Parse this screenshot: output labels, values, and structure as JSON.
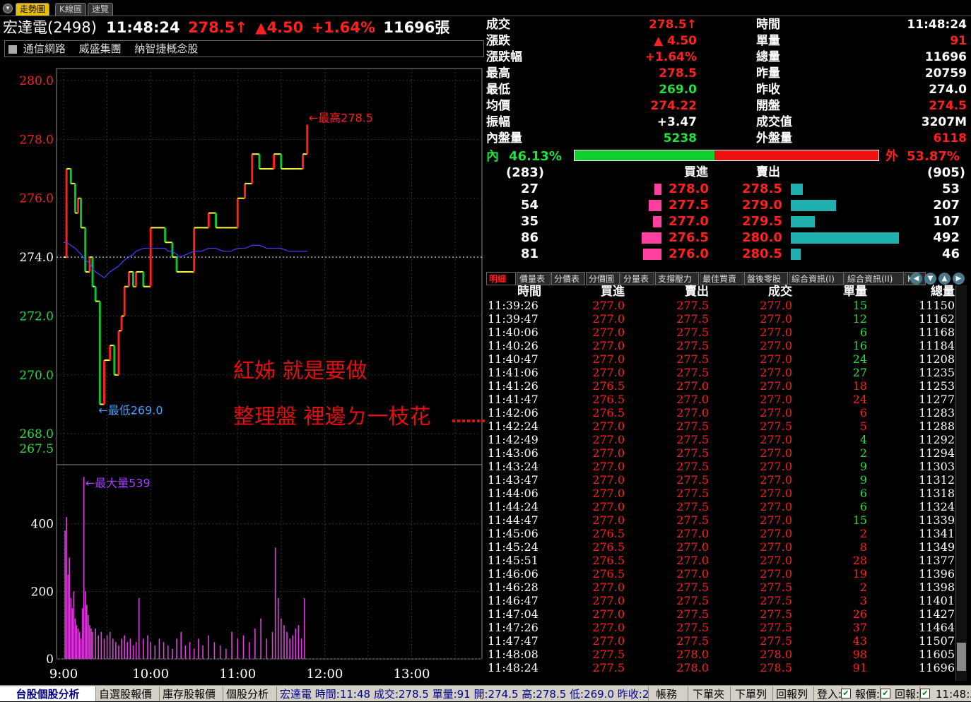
{
  "tabs": [
    {
      "label": "走勢圖"
    },
    {
      "label": "K線圖"
    },
    {
      "label": "速覽"
    }
  ],
  "stock": {
    "name": "宏達電(2498)",
    "time": "11:48:24",
    "price": "278.5",
    "price_arrow": "↑",
    "change": "▲4.50",
    "change_pct": "+1.64%",
    "volume": "11696張"
  },
  "tags": [
    "通信網路",
    "威盛集團",
    "納智捷概念股"
  ],
  "chart_data": [
    {
      "type": "line",
      "title": "",
      "x": [
        "9:00",
        "9:02",
        "9:05",
        "9:08",
        "9:10",
        "9:12",
        "9:15",
        "9:18",
        "9:20",
        "9:22",
        "9:25",
        "9:28",
        "9:30",
        "9:32",
        "9:35",
        "9:38",
        "9:40",
        "9:42",
        "9:45",
        "9:48",
        "9:50",
        "9:55",
        "10:00",
        "10:05",
        "10:10",
        "10:12",
        "10:15",
        "10:18",
        "10:20",
        "10:25",
        "10:30",
        "10:35",
        "10:40",
        "10:45",
        "10:50",
        "10:55",
        "11:00",
        "11:05",
        "11:10",
        "11:15",
        "11:20",
        "11:25",
        "11:30",
        "11:35",
        "11:40",
        "11:45",
        "11:48"
      ],
      "series": [
        {
          "values": [
            274.0,
            277.0,
            276.5,
            275.5,
            276.0,
            275.0,
            273.5,
            274.0,
            273.0,
            272.5,
            269.0,
            270.5,
            270.5,
            271.0,
            270.0,
            271.5,
            272.0,
            273.0,
            273.5,
            273.0,
            273.5,
            273.0,
            275.0,
            275.0,
            274.5,
            274.5,
            274.0,
            273.5,
            273.5,
            273.5,
            275.0,
            275.0,
            275.5,
            275.0,
            275.0,
            275.0,
            276.0,
            276.5,
            277.5,
            277.0,
            277.0,
            277.5,
            277.0,
            277.0,
            277.0,
            277.5,
            278.5
          ],
          "color": "#ffffff"
        },
        {
          "values": [
            274.5,
            274.5,
            274.4,
            274.3,
            274.2,
            274.1,
            273.9,
            273.8,
            273.6,
            273.5,
            273.4,
            273.3,
            273.4,
            273.5,
            273.6,
            273.7,
            273.8,
            273.9,
            274.0,
            274.1,
            274.2,
            274.3,
            274.3,
            274.3,
            274.3,
            274.2,
            274.2,
            274.1,
            274.0,
            274.1,
            274.2,
            274.2,
            274.3,
            274.3,
            274.2,
            274.2,
            274.3,
            274.3,
            274.4,
            274.4,
            274.3,
            274.3,
            274.3,
            274.2,
            274.2,
            274.2,
            274.2
          ],
          "color": "#4040ff"
        }
      ],
      "reference": 274.0,
      "y_ticks": [
        "280.0",
        "278.0",
        "276.0",
        "274.0",
        "272.0",
        "270.0",
        "268.0",
        "267.5"
      ],
      "ylim": [
        267.5,
        280.0
      ],
      "x_ticks": [
        "9:00",
        "10:00",
        "11:00",
        "12:00",
        "13:00"
      ],
      "annotations": {
        "high": "←最高278.5",
        "low": "←最低269.0"
      }
    },
    {
      "type": "bar",
      "title": "",
      "x_minutes": [
        1,
        2,
        3,
        4,
        5,
        6,
        7,
        8,
        9,
        10,
        11,
        12,
        13,
        14,
        15,
        16,
        17,
        18,
        19,
        20,
        22,
        24,
        26,
        28,
        30,
        32,
        34,
        36,
        38,
        40,
        42,
        44,
        46,
        48,
        50,
        52,
        55,
        58,
        60,
        63,
        66,
        69,
        72,
        75,
        78,
        81,
        84,
        87,
        90,
        93,
        96,
        100,
        104,
        108,
        112,
        116,
        120,
        124,
        128,
        132,
        136,
        140,
        144,
        146,
        148,
        150,
        152,
        154,
        156,
        158,
        160,
        162,
        164,
        166
      ],
      "values": [
        380,
        420,
        250,
        300,
        180,
        150,
        200,
        120,
        100,
        90,
        80,
        60,
        150,
        539,
        200,
        160,
        130,
        100,
        90,
        80,
        90,
        70,
        80,
        60,
        70,
        80,
        60,
        50,
        40,
        60,
        70,
        50,
        60,
        40,
        50,
        180,
        60,
        70,
        50,
        40,
        60,
        50,
        40,
        30,
        60,
        80,
        40,
        50,
        30,
        60,
        40,
        70,
        50,
        40,
        30,
        80,
        60,
        70,
        50,
        90,
        120,
        60,
        80,
        330,
        180,
        120,
        100,
        80,
        60,
        70,
        90,
        100,
        60,
        180
      ],
      "color": "#e040e0",
      "y_ticks": [
        "400",
        "200",
        "0"
      ],
      "ylim": [
        0,
        550
      ],
      "annotations": {
        "max": "←最大量539"
      }
    }
  ],
  "overlay_text": {
    "line1": "紅姊 就是要做",
    "line2": "整理盤 裡邊ㄉ一枝花"
  },
  "quote": {
    "left": [
      {
        "label": "成交",
        "value": "278.5↑",
        "color": "red"
      },
      {
        "label": "漲跌",
        "value": "▲ 4.50",
        "color": "red"
      },
      {
        "label": "漲跌幅",
        "value": "+1.64%",
        "color": "red"
      },
      {
        "label": "最高",
        "value": "278.5",
        "color": "red"
      },
      {
        "label": "最低",
        "value": "269.0",
        "color": "green"
      },
      {
        "label": "均價",
        "value": "274.22",
        "color": "red"
      },
      {
        "label": "振幅",
        "value": "+3.47",
        "color": "white"
      },
      {
        "label": "內盤量",
        "value": "5238",
        "color": "green"
      }
    ],
    "right": [
      {
        "label": "時間",
        "value": "11:48:24",
        "color": "white"
      },
      {
        "label": "單量",
        "value": "91",
        "color": "red"
      },
      {
        "label": "總量",
        "value": "11696",
        "color": "white"
      },
      {
        "label": "昨量",
        "value": "20759",
        "color": "white"
      },
      {
        "label": "昨收",
        "value": "274.0",
        "color": "white"
      },
      {
        "label": "開盤",
        "value": "274.5",
        "color": "red"
      },
      {
        "label": "成交值",
        "value": "3207M",
        "color": "white"
      },
      {
        "label": "外盤量",
        "value": "6118",
        "color": "red"
      }
    ],
    "inner_label": "內",
    "inner_pct": "46.13%",
    "inner_ratio": 0.4613,
    "outer_label": "外",
    "outer_pct": "53.87%"
  },
  "orderbook": {
    "bid_total": "(283)",
    "ask_total": "(905)",
    "bid_header": "買進",
    "ask_header": "賣出",
    "rows": [
      {
        "bid_qty": "27",
        "bid_price": "278.0",
        "ask_price": "278.5",
        "ask_qty": "53",
        "bid_frac": 0.06,
        "ask_frac": 0.11
      },
      {
        "bid_qty": "54",
        "bid_price": "277.5",
        "ask_price": "279.0",
        "ask_qty": "207",
        "bid_frac": 0.11,
        "ask_frac": 0.42
      },
      {
        "bid_qty": "35",
        "bid_price": "277.0",
        "ask_price": "279.5",
        "ask_qty": "107",
        "bid_frac": 0.07,
        "ask_frac": 0.22
      },
      {
        "bid_qty": "86",
        "bid_price": "276.5",
        "ask_price": "280.0",
        "ask_qty": "492",
        "bid_frac": 0.17,
        "ask_frac": 1.0
      },
      {
        "bid_qty": "81",
        "bid_price": "276.0",
        "ask_price": "280.5",
        "ask_qty": "46",
        "bid_frac": 0.16,
        "ask_frac": 0.09
      }
    ]
  },
  "detail_tabs": [
    "明細",
    "價量表",
    "分價表",
    "分價圖",
    "分量表",
    "支撐壓力",
    "最佳買賣",
    "盤後零股",
    "綜合資訊(I)",
    "綜合資訊(II)",
    "K..."
  ],
  "tick_headers": [
    "時間",
    "買進",
    "賣出",
    "成交",
    "單量",
    "總量"
  ],
  "ticks": [
    [
      "11:39:26",
      "277.0",
      "277.5",
      "277.0",
      "15",
      "11150"
    ],
    [
      "11:39:47",
      "277.0",
      "277.5",
      "277.0",
      "12",
      "11162"
    ],
    [
      "11:40:06",
      "277.0",
      "277.5",
      "277.0",
      "6",
      "11168"
    ],
    [
      "11:40:26",
      "277.0",
      "277.5",
      "277.0",
      "16",
      "11184"
    ],
    [
      "11:40:47",
      "277.0",
      "277.5",
      "277.0",
      "24",
      "11208"
    ],
    [
      "11:41:06",
      "277.0",
      "277.5",
      "277.0",
      "27",
      "11235"
    ],
    [
      "11:41:26",
      "276.5",
      "277.0",
      "277.0",
      "18",
      "11253"
    ],
    [
      "11:41:47",
      "276.5",
      "277.0",
      "277.0",
      "24",
      "11277"
    ],
    [
      "11:42:06",
      "276.5",
      "277.0",
      "277.0",
      "6",
      "11283"
    ],
    [
      "11:42:24",
      "277.0",
      "277.5",
      "277.5",
      "5",
      "11288"
    ],
    [
      "11:42:49",
      "277.0",
      "277.5",
      "277.0",
      "4",
      "11292"
    ],
    [
      "11:43:06",
      "277.0",
      "277.5",
      "277.0",
      "2",
      "11294"
    ],
    [
      "11:43:24",
      "277.0",
      "277.5",
      "277.0",
      "9",
      "11303"
    ],
    [
      "11:43:47",
      "277.0",
      "277.5",
      "277.0",
      "9",
      "11312"
    ],
    [
      "11:44:06",
      "277.0",
      "277.5",
      "277.0",
      "6",
      "11318"
    ],
    [
      "11:44:24",
      "277.0",
      "277.5",
      "277.0",
      "6",
      "11324"
    ],
    [
      "11:44:47",
      "277.0",
      "277.5",
      "277.0",
      "15",
      "11339"
    ],
    [
      "11:45:06",
      "276.5",
      "277.0",
      "277.0",
      "2",
      "11341"
    ],
    [
      "11:45:24",
      "276.5",
      "277.0",
      "277.0",
      "8",
      "11349"
    ],
    [
      "11:45:51",
      "276.5",
      "277.0",
      "277.0",
      "28",
      "11377"
    ],
    [
      "11:46:06",
      "276.5",
      "277.0",
      "277.0",
      "19",
      "11396"
    ],
    [
      "11:46:28",
      "277.0",
      "277.5",
      "277.5",
      "2",
      "11398"
    ],
    [
      "11:46:47",
      "277.0",
      "277.5",
      "277.5",
      "3",
      "11401"
    ],
    [
      "11:47:04",
      "277.0",
      "277.5",
      "277.5",
      "26",
      "11427"
    ],
    [
      "11:47:26",
      "277.0",
      "277.5",
      "277.5",
      "37",
      "11464"
    ],
    [
      "11:47:47",
      "277.0",
      "277.5",
      "277.5",
      "43",
      "11507"
    ],
    [
      "11:48:08",
      "277.5",
      "278.0",
      "278.0",
      "98",
      "11605"
    ],
    [
      "11:48:24",
      "277.5",
      "278.0",
      "278.5",
      "91",
      "11696"
    ]
  ],
  "tick_qty_colors": [
    "green",
    "green",
    "green",
    "green",
    "green",
    "green",
    "red",
    "red",
    "red",
    "red",
    "green",
    "green",
    "green",
    "green",
    "green",
    "green",
    "green",
    "red",
    "red",
    "red",
    "red",
    "red",
    "red",
    "red",
    "red",
    "red",
    "red",
    "red"
  ],
  "status": {
    "active_tab": "台股個股分析",
    "tabs": [
      "自選股報價",
      "庫存股報價",
      "個股分析"
    ],
    "ticker": "宏達電 時間:11:48 成交:278.5 單量:91 開:274.5 高:278.5 低:269.0 昨收:274.0",
    "items": [
      "帳務",
      "下單夾",
      "下單列",
      "回報列",
      "登入:",
      "報價:",
      "回報:"
    ],
    "clock": "11:48:3"
  }
}
